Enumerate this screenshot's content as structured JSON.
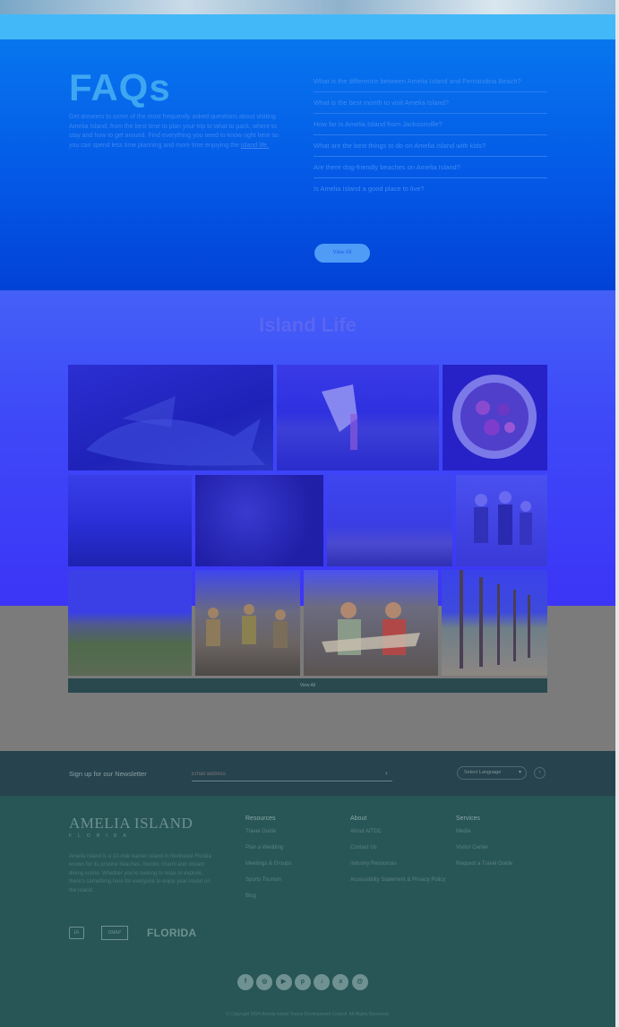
{
  "faq": {
    "title": "FAQs",
    "intro": "Get answers to some of the most frequently asked questions about visiting Amelia Island, from the best time to plan your trip to what to pack, where to stay and how to get around. Find everything you need to know right here so you can spend less time planning and more time enjoying the",
    "intro_link": "island life.",
    "questions": [
      "What is the difference between Amelia Island and Fernandina Beach?",
      "What is the best month to visit Amelia Island?",
      "How far is Amelia Island from Jacksonville?",
      "What are the best things to do on Amelia Island with kids?",
      "Are there dog-friendly beaches on Amelia Island?",
      "Is Amelia Island a good place to live?"
    ],
    "button_label": "View All"
  },
  "island_life": {
    "title": "Island Life",
    "view_all_label": "View All"
  },
  "newsletter": {
    "label": "Sign up for our Newsletter",
    "placeholder": "Email address",
    "arrow": "›",
    "language": "Select Language",
    "lang_chevron": "▾",
    "go": "›"
  },
  "footer": {
    "logo_main": "AMELIA ISLAND",
    "logo_sub": "FLORIDA",
    "description": "Amelia Island is a 13-mile barrier island in Northeast Florida known for its pristine beaches, historic charm and vibrant dining scene. Whether you're looking to relax or explore, there's something here for everyone to enjoy year-round on the island.",
    "badge_ia": "IA",
    "badge_dmap": "DMAP",
    "badge_florida": "FLORIDA",
    "columns": [
      {
        "heading": "Resources",
        "links": [
          "Travel Guide",
          "Plan a Wedding",
          "Meetings & Groups",
          "Sports Tourism",
          "Blog"
        ]
      },
      {
        "heading": "About",
        "links": [
          "About AITDC",
          "Contact Us",
          "Industry Resources",
          "Accessibility Statement & Privacy Policy"
        ]
      },
      {
        "heading": "Services",
        "links": [
          "Media",
          "Visitor Center",
          "Request a Travel Guide"
        ]
      }
    ],
    "social_icons": [
      "facebook-icon",
      "instagram-icon",
      "youtube-icon",
      "pinterest-icon",
      "tiktok-icon",
      "x-icon",
      "threads-icon"
    ],
    "social_glyphs": [
      "f",
      "◎",
      "▶",
      "p",
      "♪",
      "x",
      "@"
    ],
    "copyright": "© Copyright 2024 Amelia Island Tourist Development Council. All Rights Reserved."
  },
  "colors": {
    "faq_bg": "#0459e6",
    "island_bg": "#3e49f8",
    "newsletter_bg": "#27434d",
    "footer_bg": "#285556"
  }
}
